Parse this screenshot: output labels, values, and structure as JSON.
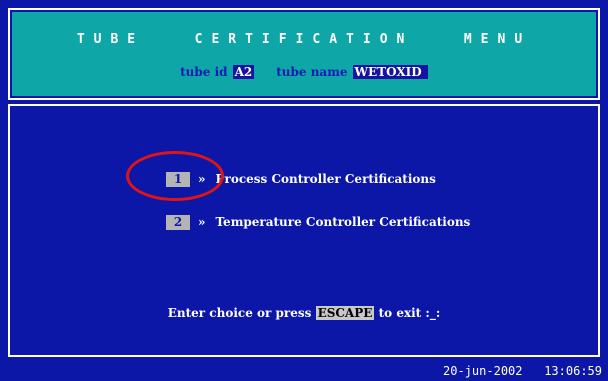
{
  "header": {
    "title": "TUBE   CERTIFICATION   MENU",
    "tube_id_label": "tube id",
    "tube_id_value": "A2",
    "tube_name_label": "tube name",
    "tube_name_value": "WETOXID "
  },
  "menu": {
    "options": [
      {
        "number": "1",
        "arrow": "»",
        "label": "Process Controller Certifications"
      },
      {
        "number": "2",
        "arrow": "»",
        "label": "Temperature Controller Certifications"
      }
    ]
  },
  "prompt": {
    "before": "Enter choice or press",
    "key": "ESCAPE",
    "after": "to exit :_:"
  },
  "status": {
    "date": "20-jun-2002",
    "time": "13:06:59"
  },
  "colors": {
    "background": "#0c17a8",
    "header_panel": "#0ea6a6",
    "annotation_ring": "#e01414"
  }
}
